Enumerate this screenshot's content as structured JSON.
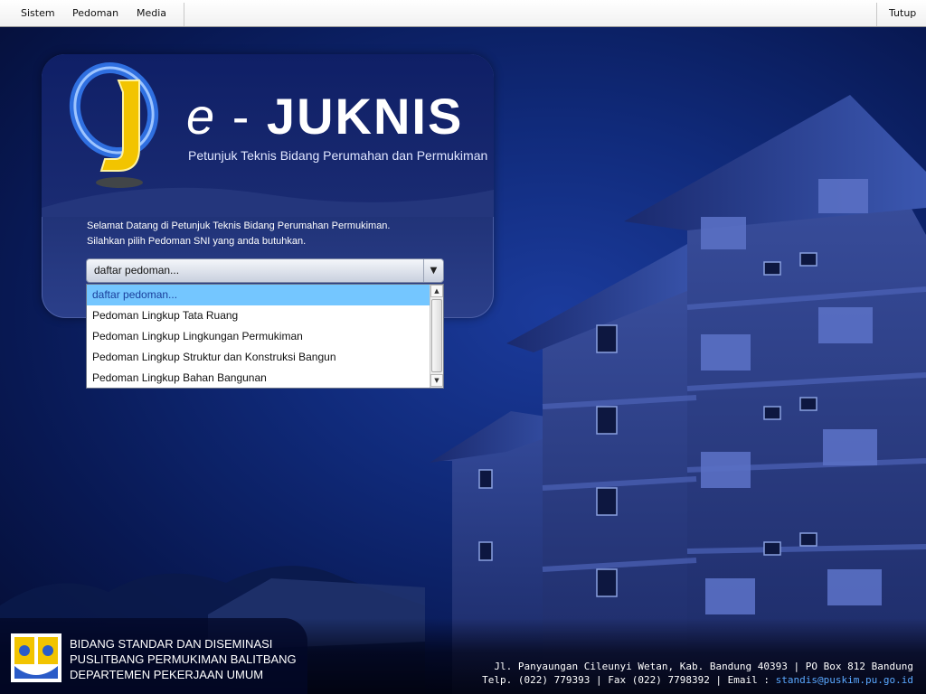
{
  "menubar": {
    "items": [
      "Sistem",
      "Pedoman",
      "Media"
    ],
    "right": "Tutup"
  },
  "app": {
    "logo_e": "e",
    "logo_dash": " - ",
    "logo_juknis": "JUKNIS",
    "tagline": "Petunjuk Teknis Bidang Perumahan dan Permukiman"
  },
  "welcome": {
    "line1": "Selamat Datang di Petunjuk Teknis Bidang Perumahan Permukiman.",
    "line2": "Silahkan pilih Pedoman SNI yang anda butuhkan."
  },
  "dropdown": {
    "selected": "daftar pedoman...",
    "options": [
      "daftar pedoman...",
      "Pedoman Lingkup Tata Ruang",
      "Pedoman Lingkup Lingkungan Permukiman",
      "Pedoman Lingkup Struktur dan Konstruksi Bangun",
      "Pedoman Lingkup Bahan Bangunan"
    ]
  },
  "footer": {
    "org_lines": [
      "BIDANG STANDAR DAN DISEMINASI",
      "PUSLITBANG PERMUKIMAN BALITBANG",
      "DEPARTEMEN PEKERJAAN UMUM"
    ],
    "address_line1": "Jl. Panyaungan Cileunyi Wetan, Kab. Bandung 40393 | PO Box 812 Bandung",
    "address_line2_prefix": "Telp. (022) 779393 | Fax (022) 7798392 | Email : ",
    "email": "standis@puskim.pu.go.id"
  },
  "colors": {
    "background": "#102a7a",
    "selected_option": "#74c6ff",
    "email_link": "#5aa8ff",
    "logo_gold": "#f2c400",
    "logo_blue": "#2f6fe0"
  }
}
